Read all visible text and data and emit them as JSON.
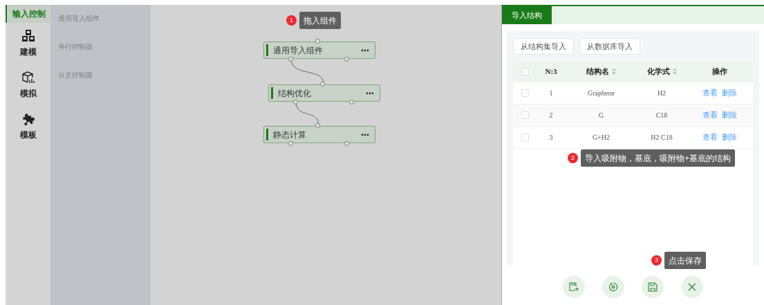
{
  "sidebar": {
    "items": [
      {
        "label": "输入控制",
        "kind": "plain",
        "selected": true
      },
      {
        "label": "建模",
        "kind": "blocks",
        "selected": false
      },
      {
        "label": "模拟",
        "kind": "model",
        "selected": false
      },
      {
        "label": "模板",
        "kind": "puzzle",
        "selected": false
      }
    ]
  },
  "palette": {
    "items": [
      "通用导入组件",
      "并行控制器",
      "分支控制器"
    ]
  },
  "canvas": {
    "nodes": [
      {
        "label": "通用导入组件"
      },
      {
        "label": "结构优化"
      },
      {
        "label": "静态计算"
      }
    ]
  },
  "guides": [
    {
      "number": "1",
      "text": "拖入组件"
    },
    {
      "number": "2",
      "text": "导入吸附物，基底，吸附物+基底的结构"
    },
    {
      "number": "3",
      "text": "点击保存"
    }
  ],
  "panel": {
    "tab": {
      "label": "导入结构",
      "selected": true
    },
    "buttons": [
      "从结构集导入",
      "从数据库导入"
    ],
    "table": {
      "select_all": {
        "checked": false
      },
      "columns": [
        {
          "label": "N:3",
          "sortable": false
        },
        {
          "label": "结构名",
          "sortable": true
        },
        {
          "label": "化学式",
          "sortable": true
        },
        {
          "label": "操作",
          "sortable": false
        }
      ],
      "rows": [
        {
          "checked": false,
          "index": "1",
          "name": "Graphene",
          "formula": "H2",
          "actions": [
            "查看",
            "删除"
          ]
        },
        {
          "checked": false,
          "index": "2",
          "name": "G",
          "formula": "C18",
          "actions": [
            "查看",
            "删除"
          ]
        },
        {
          "checked": false,
          "index": "3",
          "name": "G+H2",
          "formula": "H2 C18",
          "actions": [
            "查看",
            "删除"
          ]
        }
      ]
    }
  }
}
